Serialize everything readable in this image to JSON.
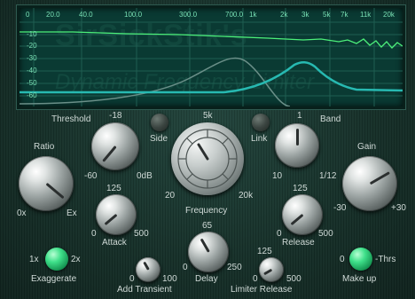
{
  "display": {
    "bg_title": "SirSickStik's",
    "bg_subtitle": "Dynamic Frequency Limiter",
    "hz_labels": [
      "0",
      "20.0",
      "40.0",
      "100.0",
      "300.0",
      "700.0",
      "1k",
      "2k",
      "3k",
      "5k",
      "7k",
      "11k",
      "20k"
    ],
    "db_labels": [
      "-10",
      "-20",
      "-30",
      "-40",
      "-50",
      "-60"
    ]
  },
  "controls": {
    "threshold": {
      "label": "Threshold",
      "value": "-18",
      "min": "-60",
      "max": "0dB"
    },
    "side": {
      "label": "Side"
    },
    "frequency": {
      "label": "Frequency",
      "value": "5k",
      "min": "20",
      "max": "20k"
    },
    "link": {
      "label": "Link"
    },
    "band": {
      "label": "Band",
      "value": "1",
      "min": "10",
      "max": "1/12"
    },
    "ratio": {
      "label": "Ratio",
      "min": "0x",
      "max": "Ex"
    },
    "gain": {
      "label": "Gain",
      "min": "-30",
      "max": "+30"
    },
    "attack": {
      "label": "Attack",
      "value": "125",
      "min": "0",
      "max": "500"
    },
    "release": {
      "label": "Release",
      "value": "125",
      "min": "0",
      "max": "500"
    },
    "exaggerate": {
      "label": "Exaggerate",
      "left": "1x",
      "right": "2x"
    },
    "add_transient": {
      "label": "Add Transient",
      "min": "0",
      "max": "100"
    },
    "delay": {
      "label": "Delay",
      "value": "65",
      "min": "0",
      "max": "250"
    },
    "limiter_release": {
      "label": "Limiter Release",
      "value": "125",
      "min": "0",
      "max": "500"
    },
    "makeup": {
      "label": "Make up",
      "left": "0",
      "right": "-Thrs"
    }
  }
}
